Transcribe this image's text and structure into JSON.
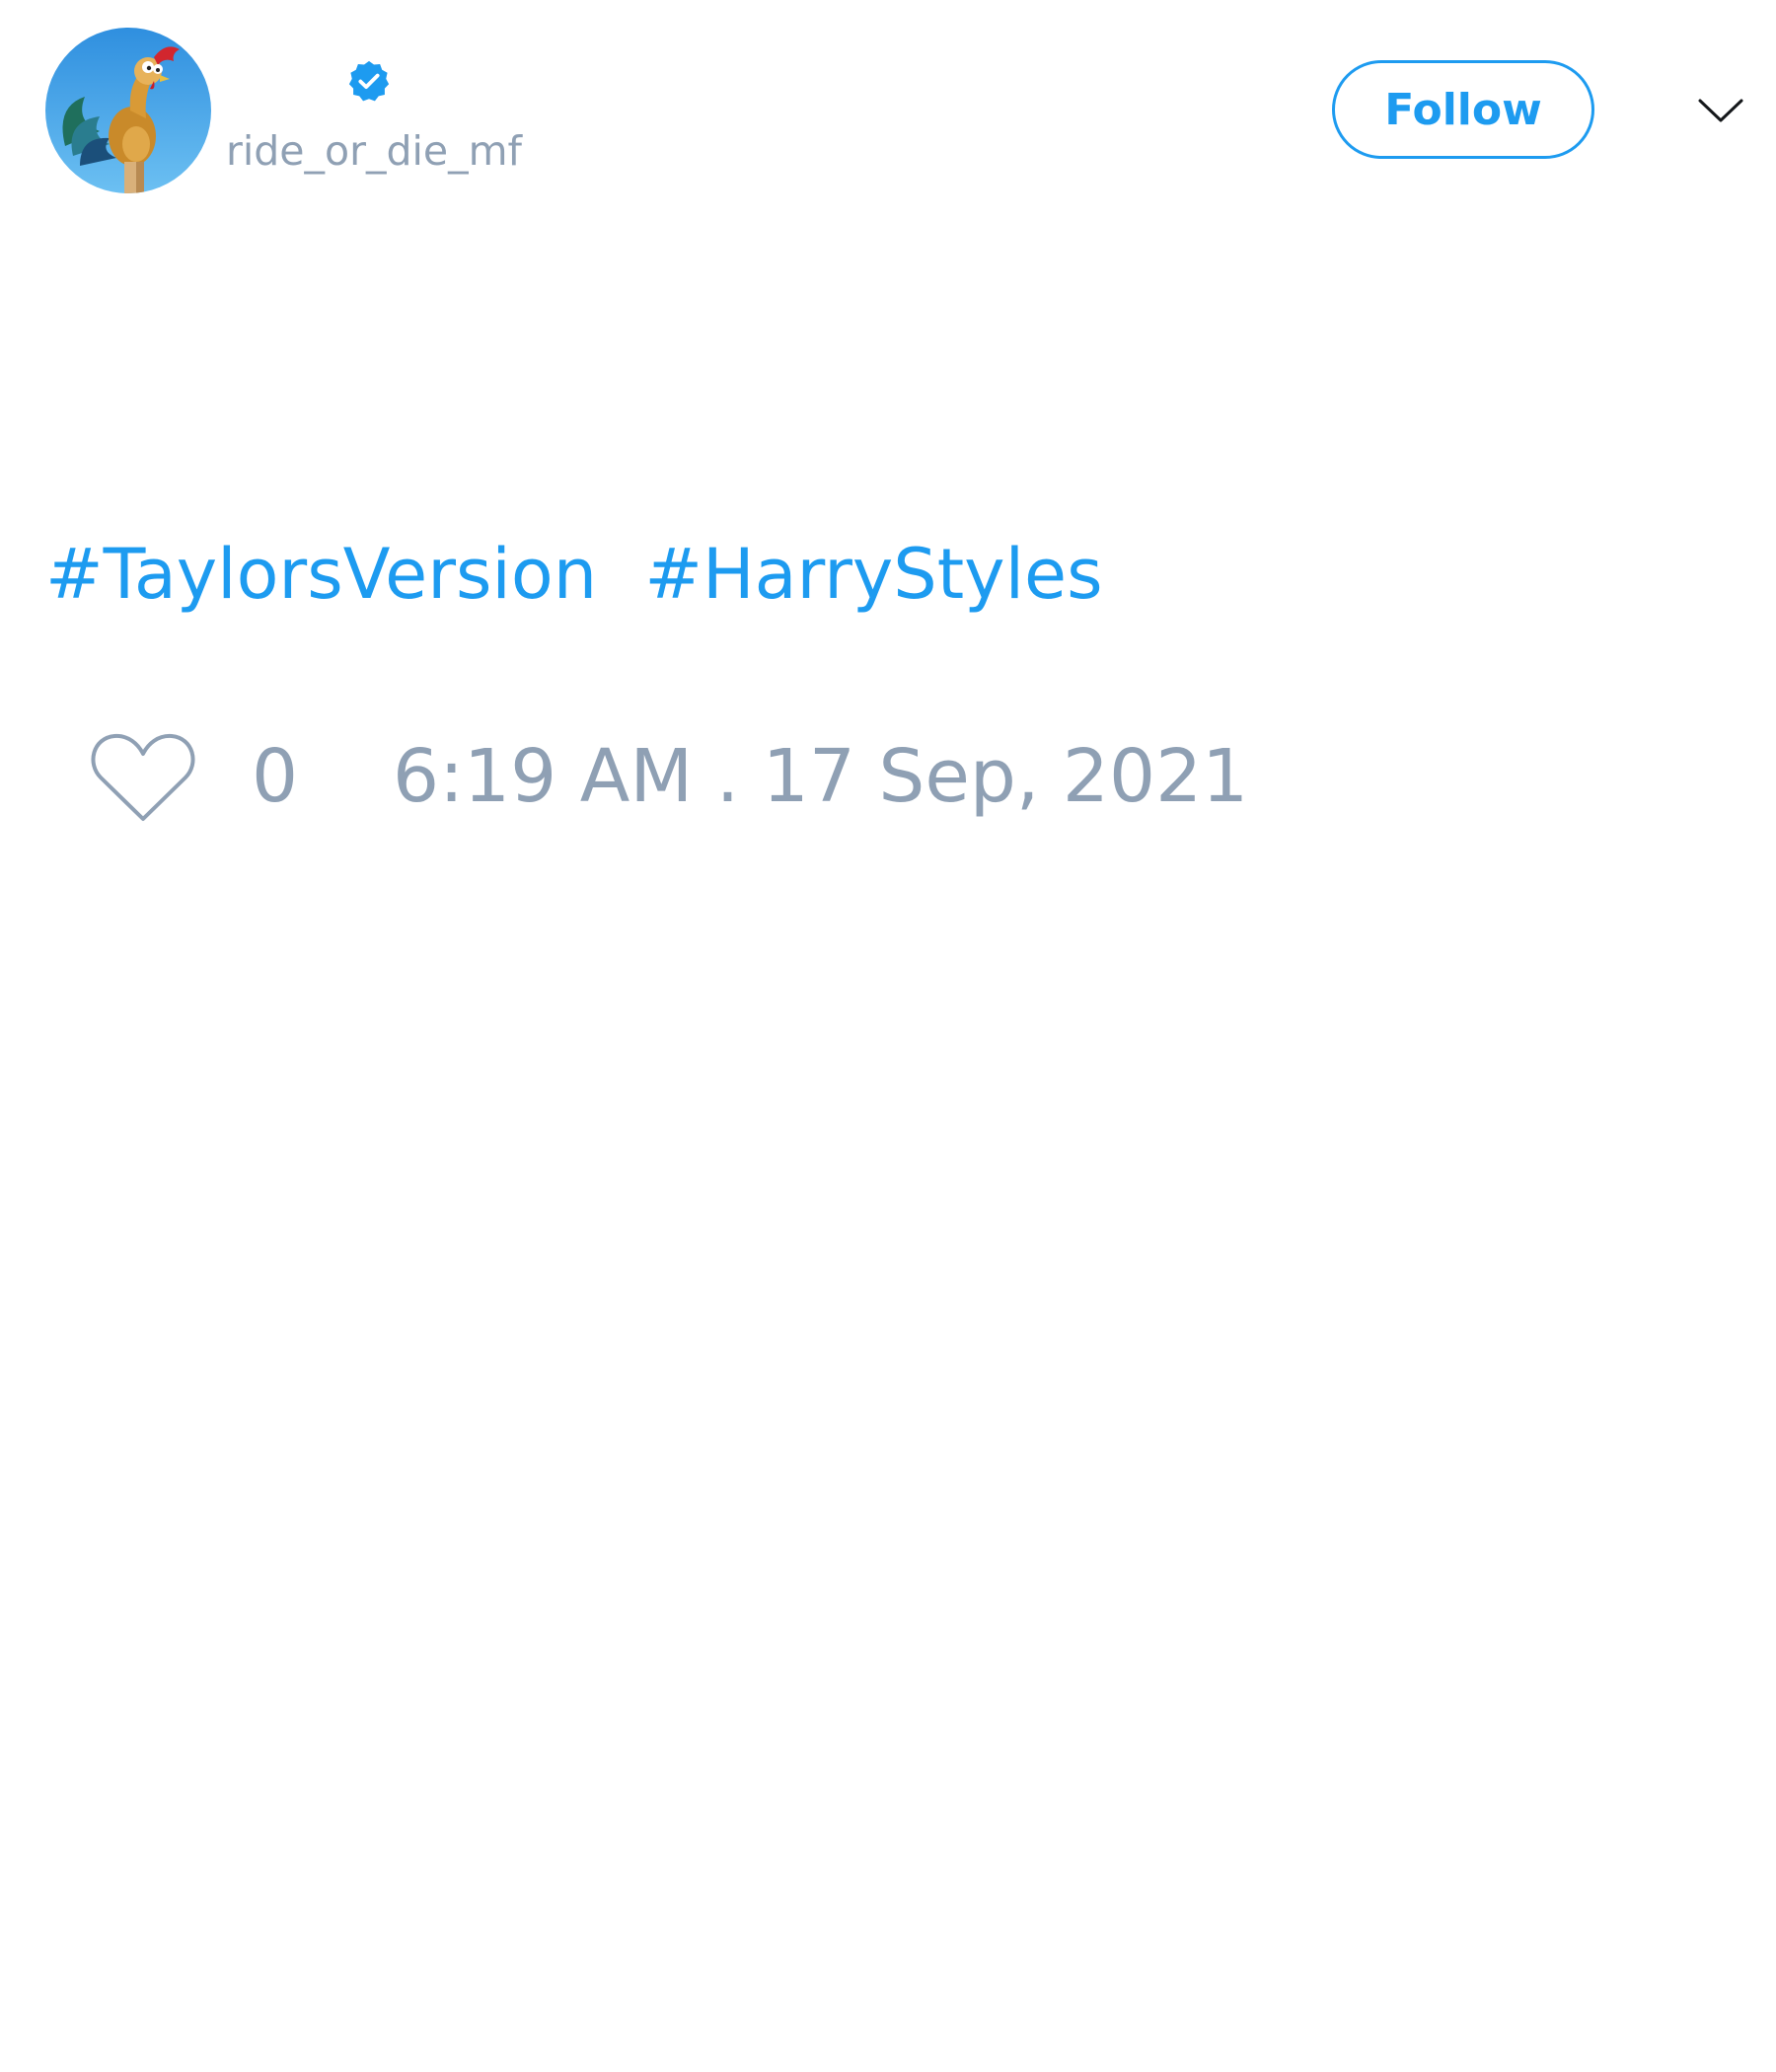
{
  "tweet": {
    "author": {
      "display_name": "",
      "handle": "ride_or_die_mf",
      "verified": true,
      "avatar_icon": "rooster-avatar"
    },
    "follow_label": "Follow",
    "menu_icon": "chevron-down-icon",
    "hashtags": [
      "#TaylorsVersion",
      "#HarryStyles"
    ],
    "likes": "0",
    "like_icon": "heart-outline-icon",
    "timestamp": "6:19 AM . 17 Sep, 2021"
  },
  "colors": {
    "accent": "#1d9bf0",
    "muted_text": "#8fa0b4",
    "background": "#ffffff"
  }
}
